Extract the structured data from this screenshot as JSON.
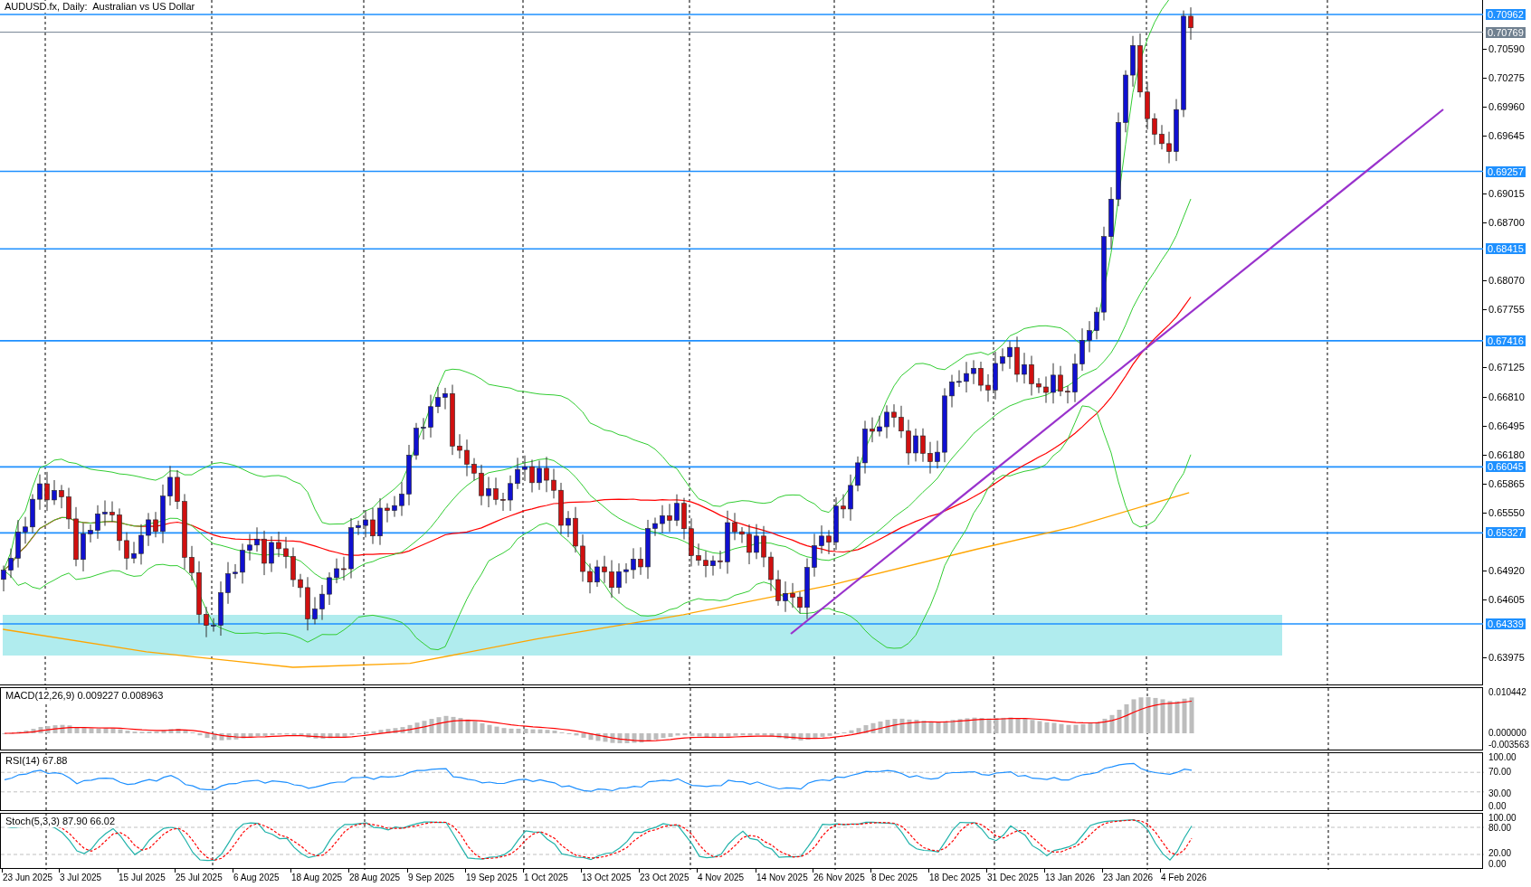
{
  "window": {
    "title": "AUDUSD.fx, Daily:  Australian vs US Dollar"
  },
  "price_axis": {
    "ticks": [
      "0.70590",
      "0.70275",
      "0.69960",
      "0.69645",
      "0.69015",
      "0.68700",
      "0.68070",
      "0.67755",
      "0.67125",
      "0.66810",
      "0.66495",
      "0.66180",
      "0.65865",
      "0.65550",
      "0.64920",
      "0.64605",
      "0.63975"
    ]
  },
  "levels": [
    {
      "label": "0.70962",
      "kind": "level"
    },
    {
      "label": "0.70769",
      "kind": "current"
    },
    {
      "label": "0.69257",
      "kind": "level"
    },
    {
      "label": "0.68415",
      "kind": "level"
    },
    {
      "label": "0.67416",
      "kind": "level"
    },
    {
      "label": "0.66045",
      "kind": "level"
    },
    {
      "label": "0.65327",
      "kind": "level"
    },
    {
      "label": "0.64339",
      "kind": "level"
    }
  ],
  "indicators": [
    {
      "kind": "macd",
      "title": "MACD(12,26,9) 0.009227 0.008963",
      "axis": [
        "0.010442",
        "0.000000",
        "-0.003563"
      ]
    },
    {
      "kind": "rsi",
      "title": "RSI(14) 67.88",
      "axis": [
        "100.00",
        "70.00",
        "30.00",
        "0.00"
      ]
    },
    {
      "kind": "stoch",
      "title": "Stoch(5,3,3) 87.90 66.02",
      "axis": [
        "100.00",
        "80.00",
        "20.00",
        "0.00"
      ]
    }
  ],
  "time_axis": {
    "labels": [
      "23 Jun 2025",
      "3 Jul 2025",
      "15 Jul 2025",
      "25 Jul 2025",
      "6 Aug 2025",
      "18 Aug 2025",
      "28 Aug 2025",
      "9 Sep 2025",
      "19 Sep 2025",
      "1 Oct 2025",
      "13 Oct 2025",
      "23 Oct 2025",
      "4 Nov 2025",
      "14 Nov 2025",
      "26 Nov 2025",
      "8 Dec 2025",
      "18 Dec 2025",
      "31 Dec 2025",
      "13 Jan 2026",
      "23 Jan 2026",
      "4 Feb 2026"
    ]
  }
}
